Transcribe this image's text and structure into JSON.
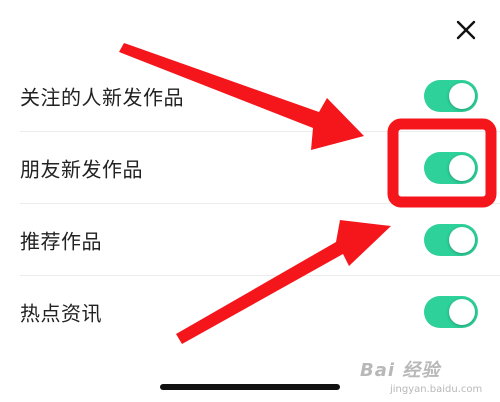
{
  "header": {
    "close_icon": "close-icon"
  },
  "settings": [
    {
      "label": "关注的人新发作品",
      "enabled": true
    },
    {
      "label": "朋友新发作品",
      "enabled": true
    },
    {
      "label": "推荐作品",
      "enabled": true
    },
    {
      "label": "热点资讯",
      "enabled": true
    }
  ],
  "colors": {
    "toggle_on": "#2ed199",
    "annotation": "#f5161c"
  },
  "watermark": {
    "text": "Bai 经验",
    "url": "jingyan.baidu.com"
  }
}
